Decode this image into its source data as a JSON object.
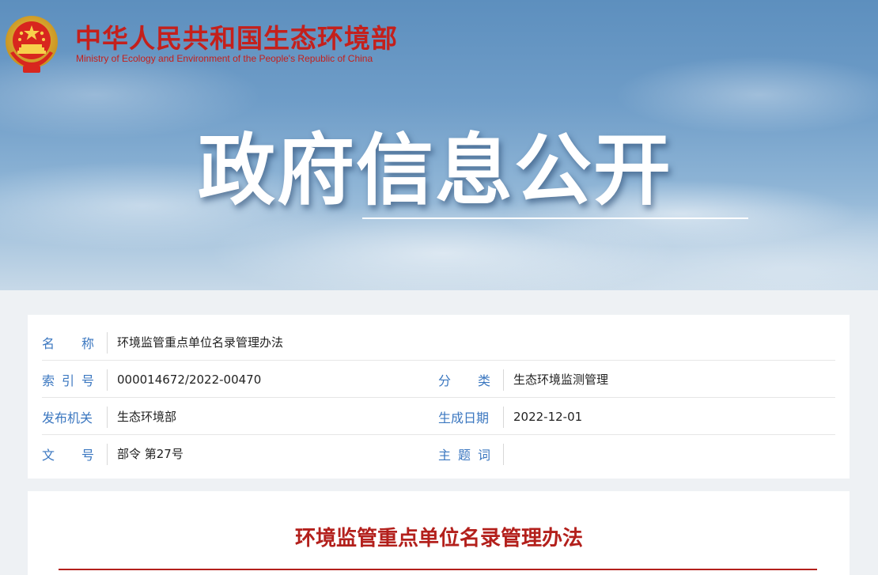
{
  "header": {
    "site_name_cn": "中华人民共和国生态环境部",
    "site_name_en": "Ministry of Ecology and Environment of the People's Republic of China",
    "emblem_icon": "national-emblem-icon",
    "banner_title": "政府信息公开"
  },
  "info": {
    "name_label": "名称",
    "name_value": "环境监管重点单位名录管理办法",
    "index_label": "索引号",
    "index_value": "000014672/2022-00470",
    "category_label": "分类",
    "category_value": "生态环境监测管理",
    "issuer_label": "发布机关",
    "issuer_value": "生态环境部",
    "date_label": "生成日期",
    "date_value": "2022-12-01",
    "doc_no_label": "文号",
    "doc_no_value": "部令 第27号",
    "keywords_label": "主题词",
    "keywords_value": ""
  },
  "document": {
    "title": "环境监管重点单位名录管理办法"
  },
  "colors": {
    "brand_red": "#c4201c",
    "label_blue": "#3b77c0",
    "title_red": "#b3201c"
  }
}
